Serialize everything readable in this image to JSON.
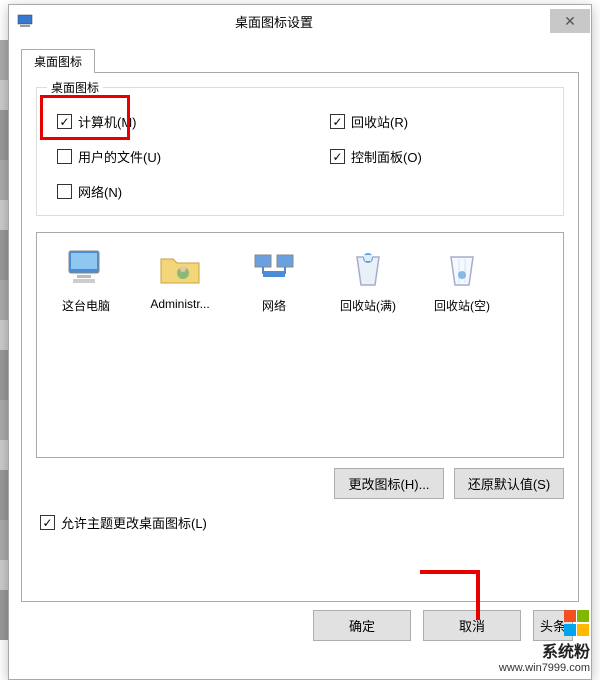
{
  "dialog": {
    "title": "桌面图标设置",
    "tab_label": "桌面图标",
    "group_legend": "桌面图标",
    "checkboxes": {
      "computer": {
        "label": "计算机(M)",
        "checked": true
      },
      "recycle": {
        "label": "回收站(R)",
        "checked": true
      },
      "userfiles": {
        "label": "用户的文件(U)",
        "checked": false
      },
      "controlpanel": {
        "label": "控制面板(O)",
        "checked": true
      },
      "network": {
        "label": "网络(N)",
        "checked": false
      }
    },
    "icons": [
      {
        "name": "这台电脑"
      },
      {
        "name": "Administr..."
      },
      {
        "name": "网络"
      },
      {
        "name": "回收站(满)"
      },
      {
        "name": "回收站(空)"
      }
    ],
    "change_icon_btn": "更改图标(H)...",
    "restore_default_btn": "还原默认值(S)",
    "allow_themes": {
      "label": "允许主题更改桌面图标(L)",
      "checked": true
    },
    "ok_btn": "确定",
    "cancel_btn": "取消",
    "apply_partial": "头条"
  },
  "watermark": {
    "site": "系统粉",
    "url": "www.win7999.com"
  },
  "colors": {
    "ms_red": "#f25022",
    "ms_green": "#7fba00",
    "ms_blue": "#00a4ef",
    "ms_yellow": "#ffb900"
  }
}
